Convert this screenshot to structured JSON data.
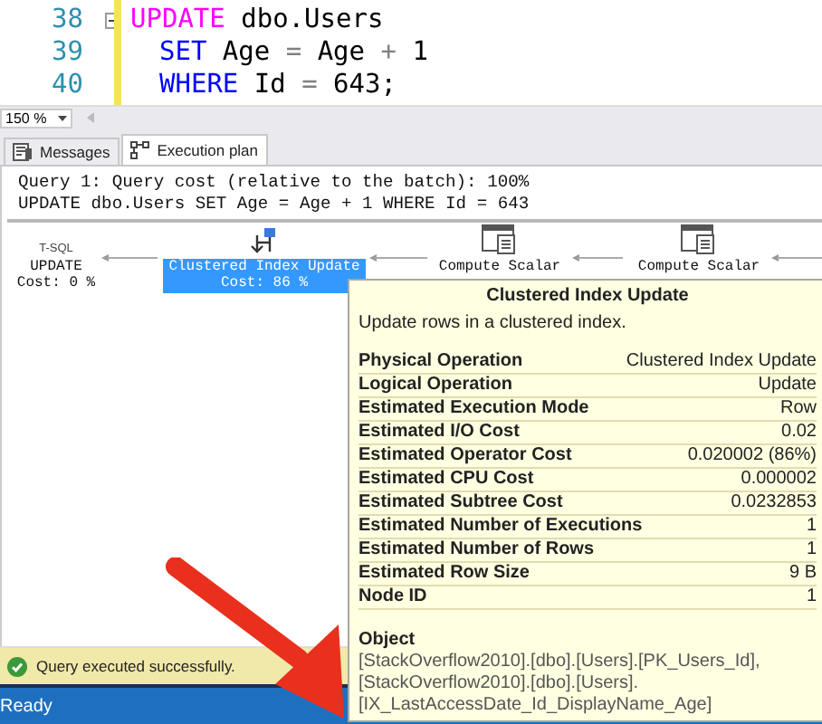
{
  "editor": {
    "lines": [
      {
        "number": "38",
        "kind": "statement",
        "fold": true,
        "tokens": [
          {
            "kind": "dml",
            "text": "UPDATE"
          },
          {
            "kind": "plain",
            "text": " dbo.Users"
          }
        ]
      },
      {
        "number": "39",
        "kind": "clause",
        "fold": false,
        "tokens": [
          {
            "kind": "keyword",
            "text": "SET"
          },
          {
            "kind": "plain",
            "text": " Age "
          },
          {
            "kind": "operator",
            "text": "="
          },
          {
            "kind": "plain",
            "text": " Age "
          },
          {
            "kind": "operator",
            "text": "+"
          },
          {
            "kind": "plain",
            "text": " 1"
          }
        ]
      },
      {
        "number": "40",
        "kind": "clause",
        "fold": false,
        "tokens": [
          {
            "kind": "keyword",
            "text": "WHERE"
          },
          {
            "kind": "plain",
            "text": " Id "
          },
          {
            "kind": "operator",
            "text": "="
          },
          {
            "kind": "plain",
            "text": " 643;"
          }
        ]
      }
    ]
  },
  "zoom": {
    "value": "150 %"
  },
  "tabs": [
    {
      "label": "Messages",
      "kind": "messages",
      "selected": false
    },
    {
      "label": "Execution plan",
      "kind": "plan",
      "selected": true
    }
  ],
  "plan": {
    "header": [
      "Query 1: Query cost (relative to the batch): 100%",
      "UPDATE dbo.Users SET Age = Age + 1 WHERE Id = 643"
    ],
    "nodes": [
      {
        "kind": "tsql",
        "icon_label": "T-SQL",
        "name": "UPDATE",
        "cost": "Cost: 0 %",
        "selected": false
      },
      {
        "kind": "clustered-index-update",
        "name": "Clustered Index Update",
        "cost": "Cost: 86 %",
        "selected": true
      },
      {
        "kind": "compute-scalar",
        "name": "Compute Scalar",
        "selected": false
      },
      {
        "kind": "compute-scalar",
        "name": "Compute Scalar",
        "selected": false
      }
    ]
  },
  "tooltip": {
    "title": "Clustered Index Update",
    "description": "Update rows in a clustered index.",
    "properties": [
      {
        "name": "Physical Operation",
        "value": "Clustered Index Update"
      },
      {
        "name": "Logical Operation",
        "value": "Update"
      },
      {
        "name": "Estimated Execution Mode",
        "value": "Row"
      },
      {
        "name": "Estimated I/O Cost",
        "value": "0.02"
      },
      {
        "name": "Estimated Operator Cost",
        "value": "0.020002 (86%)"
      },
      {
        "name": "Estimated CPU Cost",
        "value": "0.000002"
      },
      {
        "name": "Estimated Subtree Cost",
        "value": "0.0232853"
      },
      {
        "name": "Estimated Number of Executions",
        "value": "1"
      },
      {
        "name": "Estimated Number of Rows",
        "value": "1"
      },
      {
        "name": "Estimated Row Size",
        "value": "9 B"
      },
      {
        "name": "Node ID",
        "value": "1"
      }
    ],
    "object_heading": "Object",
    "object_lines": [
      "[StackOverflow2010].[dbo].[Users].[PK_Users_Id],",
      "[StackOverflow2010].[dbo].[Users].",
      "[IX_LastAccessDate_Id_DisplayName_Age]"
    ]
  },
  "status": {
    "message": "Query executed successfully.",
    "bar_text": "Ready"
  }
}
